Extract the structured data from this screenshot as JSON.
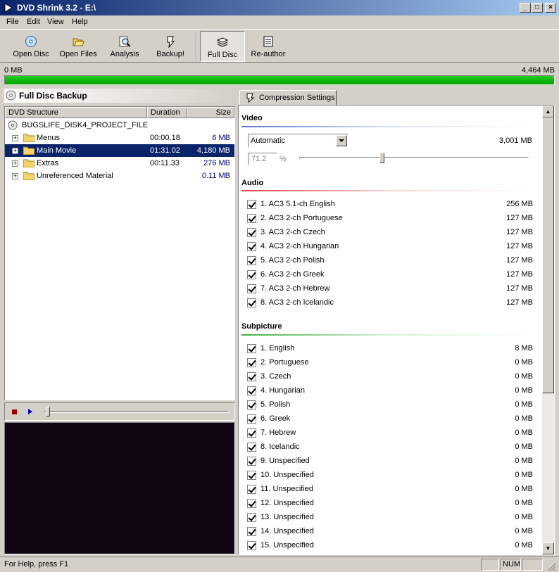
{
  "window": {
    "title": "DVD Shrink 3.2 - E:\\"
  },
  "menu": [
    "File",
    "Edit",
    "View",
    "Help"
  ],
  "toolbar": [
    {
      "label": "Open Disc",
      "icon": "disc-icon"
    },
    {
      "label": "Open Files",
      "icon": "open-folder-icon"
    },
    {
      "label": "Analysis",
      "icon": "magnifier-icon"
    },
    {
      "label": "Backup!",
      "icon": "backup-icon"
    },
    {
      "label": "Full Disc",
      "icon": "stack-icon",
      "active": true
    },
    {
      "label": "Re-author",
      "icon": "document-icon"
    }
  ],
  "progress": {
    "left": "0 MB",
    "right": "4,464 MB",
    "fill_fraction": 1.0
  },
  "left_panel": {
    "title": "Full Disc Backup",
    "columns": [
      "DVD Structure",
      "Duration",
      "Size"
    ],
    "root": "BUGSLIFE_DISK4_PROJECT_FILE",
    "rows": [
      {
        "name": "Menus",
        "duration": "00:00.18",
        "size": "6 MB"
      },
      {
        "name": "Main Movie",
        "duration": "01:31.02",
        "size": "4,180 MB",
        "selected": true
      },
      {
        "name": "Extras",
        "duration": "00:11.33",
        "size": "276 MB"
      },
      {
        "name": "Unreferenced Material",
        "duration": "",
        "size": "0.11 MB"
      }
    ]
  },
  "player": {
    "slider_fraction": 0.0
  },
  "right_panel": {
    "tab": "Compression Settings",
    "video": {
      "title": "Video",
      "mode": "Automatic",
      "size": "3,001 MB",
      "percent": "71.2",
      "percent_unit": "%",
      "slider_fraction": 0.36
    },
    "audio": {
      "title": "Audio",
      "tracks": [
        {
          "label": "1. AC3 5.1-ch English",
          "size": "256 MB"
        },
        {
          "label": "2. AC3 2-ch Portuguese",
          "size": "127 MB"
        },
        {
          "label": "3. AC3 2-ch Czech",
          "size": "127 MB"
        },
        {
          "label": "4. AC3 2-ch Hungarian",
          "size": "127 MB"
        },
        {
          "label": "5. AC3 2-ch Polish",
          "size": "127 MB"
        },
        {
          "label": "6. AC3 2-ch Greek",
          "size": "127 MB"
        },
        {
          "label": "7. AC3 2-ch Hebrew",
          "size": "127 MB"
        },
        {
          "label": "8. AC3 2-ch Icelandic",
          "size": "127 MB"
        }
      ]
    },
    "subpicture": {
      "title": "Subpicture",
      "tracks": [
        {
          "label": "1. English",
          "size": "8 MB"
        },
        {
          "label": "2. Portuguese",
          "size": "0 MB"
        },
        {
          "label": "3. Czech",
          "size": "0 MB"
        },
        {
          "label": "4. Hungarian",
          "size": "0 MB"
        },
        {
          "label": "5. Polish",
          "size": "0 MB"
        },
        {
          "label": "6. Greek",
          "size": "0 MB"
        },
        {
          "label": "7. Hebrew",
          "size": "0 MB"
        },
        {
          "label": "8. Icelandic",
          "size": "0 MB"
        },
        {
          "label": "9. Unspecified",
          "size": "0 MB"
        },
        {
          "label": "10. Unspecified",
          "size": "0 MB"
        },
        {
          "label": "11. Unspecified",
          "size": "0 MB"
        },
        {
          "label": "12. Unspecified",
          "size": "0 MB"
        },
        {
          "label": "13. Unspecified",
          "size": "0 MB"
        },
        {
          "label": "14. Unspecified",
          "size": "0 MB"
        },
        {
          "label": "15. Unspecified",
          "size": "0 MB"
        }
      ]
    }
  },
  "status": {
    "text": "For Help, press F1",
    "num": "NUM"
  },
  "colors": {
    "selection": "#0a246a",
    "progress": "#00b000",
    "video_line": "#5a7bd0",
    "audio_line": "#e04040",
    "subpicture_line": "#40b040"
  }
}
